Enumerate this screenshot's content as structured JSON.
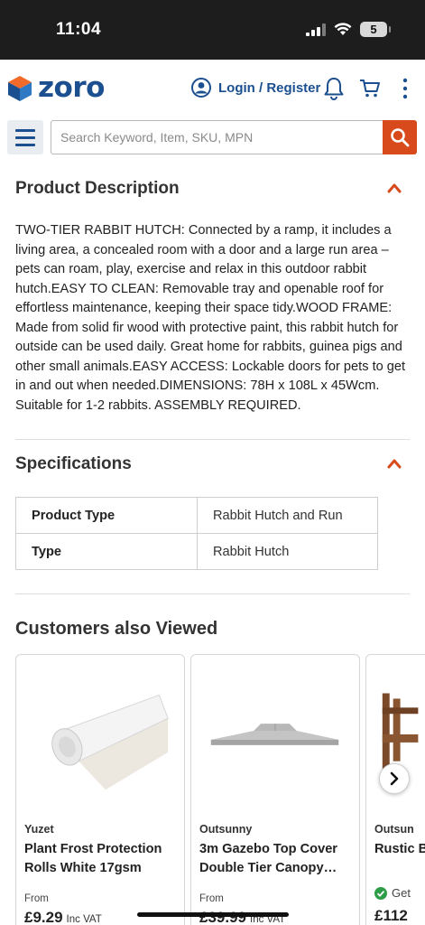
{
  "status_bar": {
    "time": "11:04",
    "battery": "5"
  },
  "header": {
    "logo_text": "zoro",
    "login_label": "Login / Register",
    "brand_color": "#1b4f8f",
    "accent_color": "#d84a1b"
  },
  "search": {
    "placeholder": "Search Keyword, Item, SKU, MPN"
  },
  "description": {
    "title": "Product Description",
    "text": "TWO-TIER RABBIT HUTCH: Connected by a ramp, it includes a living area, a concealed room with a door and a large run area – pets can roam, play, exercise and relax in this outdoor rabbit hutch.EASY TO CLEAN: Removable tray and openable roof for effortless maintenance, keeping their space tidy.WOOD FRAME: Made from solid fir wood with protective paint, this rabbit hutch for outside can be used daily. Great home for rabbits, guinea pigs and other small animals.EASY ACCESS: Lockable doors for pets to get in and out when needed.DIMENSIONS: 78H x 108L x 45Wcm. Suitable for 1-2 rabbits. ASSEMBLY REQUIRED."
  },
  "specifications": {
    "title": "Specifications",
    "rows": [
      {
        "key": "Product Type",
        "value": "Rabbit Hutch and Run"
      },
      {
        "key": "Type",
        "value": "Rabbit Hutch"
      }
    ]
  },
  "also_viewed": {
    "title": "Customers also Viewed",
    "products": [
      {
        "brand": "Yuzet",
        "name": "Plant Frost Protection Rolls White 17gsm",
        "from": "From",
        "price": "£9.29",
        "vat": "Inc VAT",
        "icon": "fleece-roll-image"
      },
      {
        "brand": "Outsunny",
        "name": "3m Gazebo Top Cover Double Tier Canopy…",
        "from": "From",
        "price": "£39.99",
        "vat": "Inc VAT",
        "icon": "gazebo-cover-image"
      },
      {
        "brand": "Outsun",
        "name": "Rustic Bench",
        "stock": "Get",
        "price": "£112",
        "icon": "wooden-bench-image"
      }
    ]
  }
}
